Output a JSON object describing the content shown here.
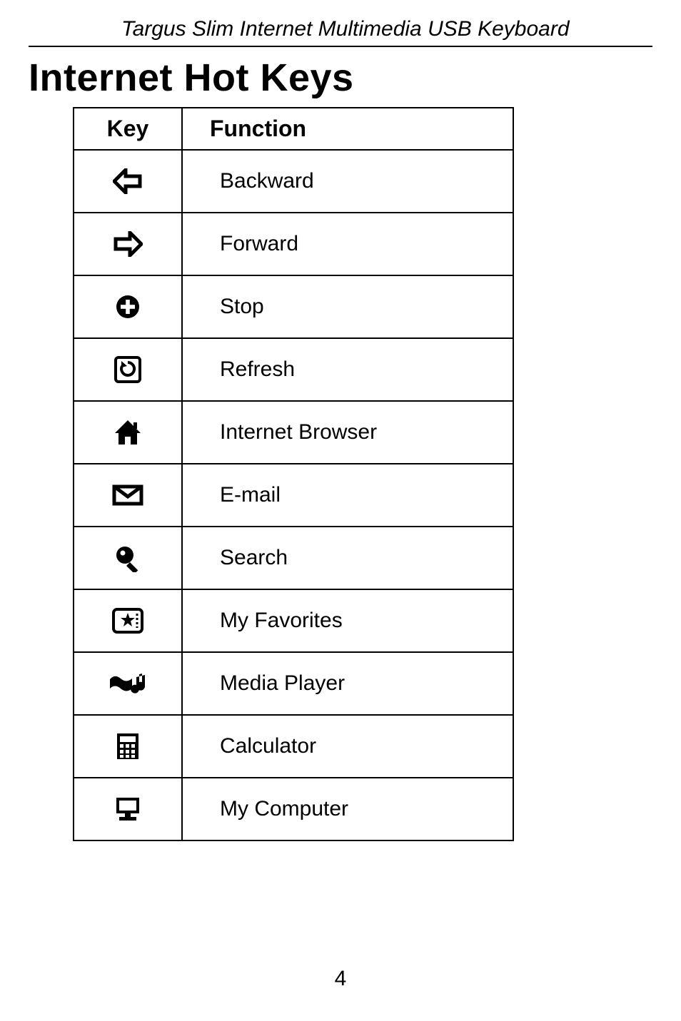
{
  "header": {
    "product_title": "Targus Slim Internet Multimedia USB Keyboard"
  },
  "section": {
    "title": "Internet Hot Keys"
  },
  "table": {
    "headers": {
      "key": "Key",
      "function": "Function"
    },
    "rows": [
      {
        "icon": "back-arrow-icon",
        "function": "Backward"
      },
      {
        "icon": "forward-arrow-icon",
        "function": "Forward"
      },
      {
        "icon": "stop-icon",
        "function": "Stop"
      },
      {
        "icon": "refresh-icon",
        "function": "Refresh"
      },
      {
        "icon": "home-icon",
        "function": "Internet Browser"
      },
      {
        "icon": "mail-icon",
        "function": "E-mail"
      },
      {
        "icon": "search-icon",
        "function": "Search"
      },
      {
        "icon": "favorites-icon",
        "function": "My Favorites"
      },
      {
        "icon": "media-player-icon",
        "function": "Media Player"
      },
      {
        "icon": "calculator-icon",
        "function": "Calculator"
      },
      {
        "icon": "computer-icon",
        "function": "My Computer"
      }
    ]
  },
  "page_number": "4"
}
